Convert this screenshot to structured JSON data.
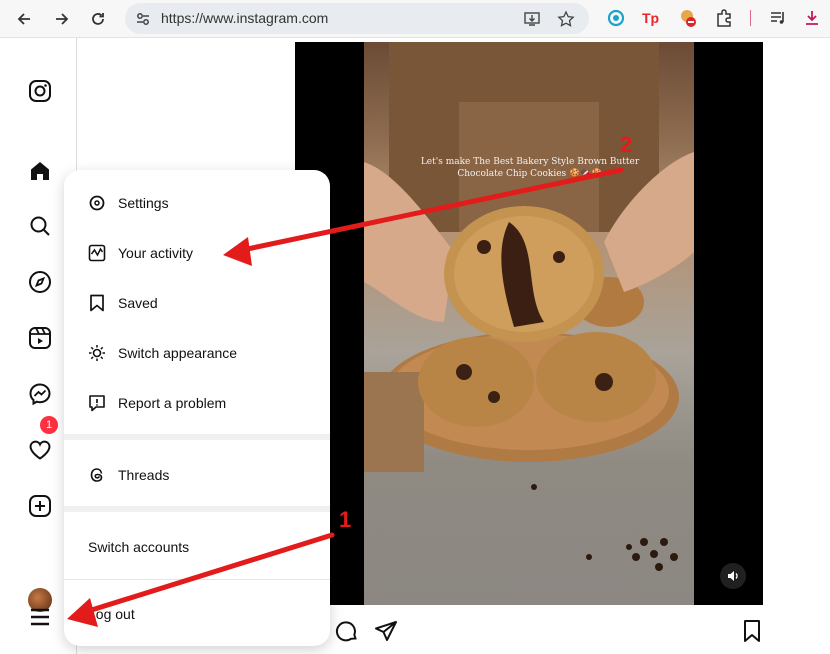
{
  "browser": {
    "url": "https://www.instagram.com",
    "icons": [
      "back-icon",
      "forward-icon",
      "reload-icon",
      "site-settings-icon",
      "install-app-icon",
      "bookmark-star-icon",
      "extensions-icon",
      "reading-list-icon",
      "download-icon"
    ]
  },
  "sidebar": {
    "icons": [
      "instagram-logo-icon",
      "home-icon",
      "search-icon",
      "explore-icon",
      "reels-icon",
      "messages-icon",
      "notifications-icon",
      "create-icon",
      "profile-avatar",
      "more-menu-icon"
    ],
    "messages_badge": "1"
  },
  "menu": {
    "items": [
      {
        "label": "Settings",
        "icon": "gear-icon"
      },
      {
        "label": "Your activity",
        "icon": "activity-icon"
      },
      {
        "label": "Saved",
        "icon": "bookmark-icon"
      },
      {
        "label": "Switch appearance",
        "icon": "sun-icon"
      },
      {
        "label": "Report a problem",
        "icon": "report-icon"
      }
    ],
    "threads": {
      "label": "Threads",
      "icon": "threads-icon"
    },
    "switch_accounts": "Switch accounts",
    "log_out": "Log out"
  },
  "post": {
    "caption": "Let's make The Best Bakery Style Brown Butter Chocolate Chip Cookies 🍪🍫🍪"
  },
  "annotations": {
    "step1": "1",
    "step2": "2",
    "color": "#e21b1b"
  }
}
